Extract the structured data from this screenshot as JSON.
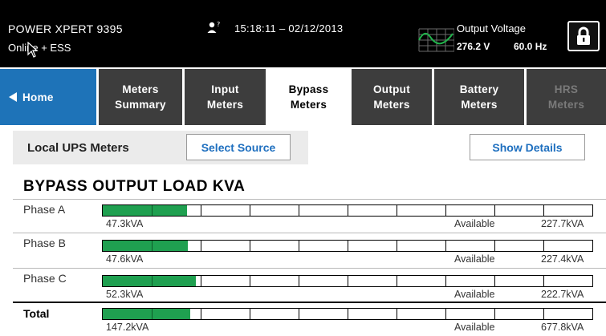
{
  "header": {
    "device_name": "POWER XPERT 9395",
    "status": "Online + ESS",
    "datetime": "15:18:11 – 02/12/2013",
    "output_voltage_label": "Output Voltage",
    "output_voltage_value": "276.2 V",
    "output_frequency_value": "60.0 Hz",
    "user_icon": "user-unknown-icon",
    "wave_icon": "sine-wave-icon",
    "lock_icon": "lock-icon"
  },
  "tabs": [
    {
      "label": "Home",
      "icon": "left-arrow-icon",
      "state": "home"
    },
    {
      "label": "Meters\nSummary",
      "state": "normal"
    },
    {
      "label": "Input\nMeters",
      "state": "normal"
    },
    {
      "label": "Bypass\nMeters",
      "state": "active"
    },
    {
      "label": "Output\nMeters",
      "state": "normal"
    },
    {
      "label": "Battery\nMeters",
      "state": "normal"
    },
    {
      "label": "HRS\nMeters",
      "state": "disabled"
    }
  ],
  "toolbar": {
    "title": "Local UPS Meters",
    "select_source_label": "Select Source",
    "show_details_label": "Show Details"
  },
  "meters": {
    "title": "BYPASS OUTPUT LOAD KVA",
    "available_label": "Available",
    "rows": [
      {
        "label": "Phase A",
        "value": "47.3kVA",
        "available": "227.7kVA",
        "fraction": 0.172
      },
      {
        "label": "Phase B",
        "value": "47.6kVA",
        "available": "227.4kVA",
        "fraction": 0.173
      },
      {
        "label": "Phase C",
        "value": "52.3kVA",
        "available": "222.7kVA",
        "fraction": 0.19
      },
      {
        "label": "Total",
        "value": "147.2kVA",
        "available": "677.8kVA",
        "fraction": 0.178
      }
    ]
  },
  "colors": {
    "header_bg": "#000000",
    "tab_bg": "#3d3d3d",
    "home_tab_bg": "#1e73b8",
    "link_blue": "#1e6fbf",
    "bar_fill": "#1fa050"
  }
}
